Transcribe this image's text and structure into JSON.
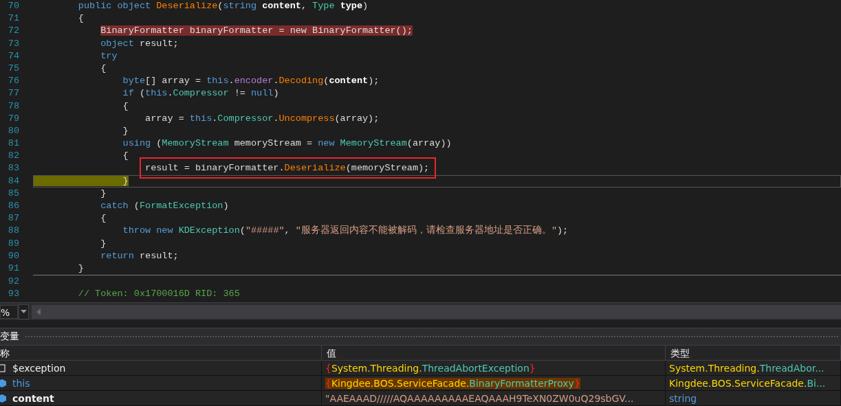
{
  "code_editor": {
    "lines": [
      {
        "number": "70",
        "tokens": [
          {
            "kind": "keyword",
            "text": "        public object "
          },
          {
            "kind": "method",
            "text": "Deserialize"
          },
          {
            "kind": "plain",
            "text": "("
          },
          {
            "kind": "keyword",
            "text": "string "
          },
          {
            "kind": "param",
            "text": "content"
          },
          {
            "kind": "plain",
            "text": ", "
          },
          {
            "kind": "type",
            "text": "Type "
          },
          {
            "kind": "param",
            "text": "type"
          },
          {
            "kind": "plain",
            "text": ")"
          }
        ]
      },
      {
        "number": "71",
        "tokens": [
          {
            "kind": "plain",
            "text": "        {"
          }
        ]
      },
      {
        "number": "72",
        "breakpoint": true,
        "tokens": [
          {
            "kind": "plain",
            "text": "            BinaryFormatter binaryFormatter = new BinaryFormatter();"
          }
        ]
      },
      {
        "number": "73",
        "tokens": [
          {
            "kind": "keyword",
            "text": "            object "
          },
          {
            "kind": "plain",
            "text": "result;"
          }
        ]
      },
      {
        "number": "74",
        "tokens": [
          {
            "kind": "keyword",
            "text": "            try"
          }
        ]
      },
      {
        "number": "75",
        "tokens": [
          {
            "kind": "plain",
            "text": "            {"
          }
        ]
      },
      {
        "number": "76",
        "tokens": [
          {
            "kind": "keyword",
            "text": "                byte"
          },
          {
            "kind": "plain",
            "text": "[] array = "
          },
          {
            "kind": "keyword",
            "text": "this"
          },
          {
            "kind": "plain",
            "text": "."
          },
          {
            "kind": "member",
            "text": "encoder"
          },
          {
            "kind": "plain",
            "text": "."
          },
          {
            "kind": "method",
            "text": "Decoding"
          },
          {
            "kind": "plain",
            "text": "("
          },
          {
            "kind": "param",
            "text": "content"
          },
          {
            "kind": "plain",
            "text": ");"
          }
        ]
      },
      {
        "number": "77",
        "tokens": [
          {
            "kind": "keyword",
            "text": "                if "
          },
          {
            "kind": "plain",
            "text": "("
          },
          {
            "kind": "keyword",
            "text": "this"
          },
          {
            "kind": "plain",
            "text": "."
          },
          {
            "kind": "type",
            "text": "Compressor"
          },
          {
            "kind": "plain",
            "text": " != "
          },
          {
            "kind": "keyword",
            "text": "null"
          },
          {
            "kind": "plain",
            "text": ")"
          }
        ]
      },
      {
        "number": "78",
        "tokens": [
          {
            "kind": "plain",
            "text": "                {"
          }
        ]
      },
      {
        "number": "79",
        "tokens": [
          {
            "kind": "plain",
            "text": "                    array = "
          },
          {
            "kind": "keyword",
            "text": "this"
          },
          {
            "kind": "plain",
            "text": "."
          },
          {
            "kind": "type",
            "text": "Compressor"
          },
          {
            "kind": "plain",
            "text": "."
          },
          {
            "kind": "method",
            "text": "Uncompress"
          },
          {
            "kind": "plain",
            "text": "(array);"
          }
        ]
      },
      {
        "number": "80",
        "tokens": [
          {
            "kind": "plain",
            "text": "                }"
          }
        ]
      },
      {
        "number": "81",
        "tokens": [
          {
            "kind": "keyword",
            "text": "                using "
          },
          {
            "kind": "plain",
            "text": "("
          },
          {
            "kind": "type",
            "text": "MemoryStream"
          },
          {
            "kind": "plain",
            "text": " memoryStream = "
          },
          {
            "kind": "keyword",
            "text": "new "
          },
          {
            "kind": "type",
            "text": "MemoryStream"
          },
          {
            "kind": "plain",
            "text": "(array))"
          }
        ]
      },
      {
        "number": "82",
        "tokens": [
          {
            "kind": "plain",
            "text": "                {"
          }
        ]
      },
      {
        "number": "83",
        "boxed": true,
        "tokens": [
          {
            "kind": "plain",
            "text": "                    result = binaryFormatter."
          },
          {
            "kind": "method",
            "text": "Deserialize"
          },
          {
            "kind": "plain",
            "text": "(memoryStream);"
          }
        ]
      },
      {
        "number": "84",
        "current": true,
        "tokens": [
          {
            "kind": "brace",
            "text": "                }"
          }
        ]
      },
      {
        "number": "85",
        "tokens": [
          {
            "kind": "plain",
            "text": "            }"
          }
        ]
      },
      {
        "number": "86",
        "tokens": [
          {
            "kind": "keyword",
            "text": "            catch "
          },
          {
            "kind": "plain",
            "text": "("
          },
          {
            "kind": "type",
            "text": "FormatException"
          },
          {
            "kind": "plain",
            "text": ")"
          }
        ]
      },
      {
        "number": "87",
        "tokens": [
          {
            "kind": "plain",
            "text": "            {"
          }
        ]
      },
      {
        "number": "88",
        "tokens": [
          {
            "kind": "keyword",
            "text": "                throw new "
          },
          {
            "kind": "type",
            "text": "KDException"
          },
          {
            "kind": "plain",
            "text": "("
          },
          {
            "kind": "string",
            "text": "\"#####\""
          },
          {
            "kind": "plain",
            "text": ", "
          },
          {
            "kind": "string",
            "text": "\"服务器返回内容不能被解码，请检查服务器地址是否正确。\""
          },
          {
            "kind": "plain",
            "text": ");"
          }
        ]
      },
      {
        "number": "89",
        "tokens": [
          {
            "kind": "plain",
            "text": "            }"
          }
        ]
      },
      {
        "number": "90",
        "tokens": [
          {
            "kind": "keyword",
            "text": "            return "
          },
          {
            "kind": "plain",
            "text": "result;"
          }
        ]
      },
      {
        "number": "91",
        "separator_below": true,
        "tokens": [
          {
            "kind": "plain",
            "text": "        }"
          }
        ]
      },
      {
        "number": "92"
      },
      {
        "number": "93",
        "tokens": [
          {
            "kind": "comment",
            "text": "        // Token: 0x1700016D RID: 365"
          }
        ]
      }
    ]
  },
  "zoom_bar": {
    "zoom_value": "%"
  },
  "locals_panel": {
    "title": "变量",
    "columns": [
      "称",
      "值",
      "类型"
    ],
    "rows": [
      {
        "kind": "exception",
        "name": "$exception",
        "value_highlighted": false,
        "value": [
          {
            "kind": "brace",
            "text": "{"
          },
          {
            "kind": "namespace",
            "text": "System.Threading."
          },
          {
            "kind": "class",
            "text": "ThreadAbortException"
          },
          {
            "kind": "brace",
            "text": "}"
          }
        ],
        "type": [
          {
            "kind": "namespace",
            "text": "System.Threading."
          },
          {
            "kind": "class",
            "text": "ThreadAbor..."
          }
        ]
      },
      {
        "kind": "this",
        "name": "this",
        "value_highlighted": true,
        "value": [
          {
            "kind": "brace",
            "text": "{"
          },
          {
            "kind": "namespace",
            "text": "Kingdee.BOS.ServiceFacade."
          },
          {
            "kind": "class",
            "text": "BinaryFormatterProxy"
          },
          {
            "kind": "brace",
            "text": "}"
          }
        ],
        "type": [
          {
            "kind": "namespace",
            "text": "Kingdee.BOS.ServiceFacade."
          },
          {
            "kind": "class",
            "text": "Bi..."
          }
        ]
      },
      {
        "kind": "parameter",
        "name": "content",
        "value_highlighted": false,
        "value": [
          {
            "kind": "string",
            "text": "\"AAEAAAD/////AQAAAAAAAAAEAQAAAH9TeXN0ZW0uQ29sbGV..."
          }
        ],
        "type": [
          {
            "kind": "keyword",
            "text": "string"
          }
        ]
      }
    ]
  }
}
